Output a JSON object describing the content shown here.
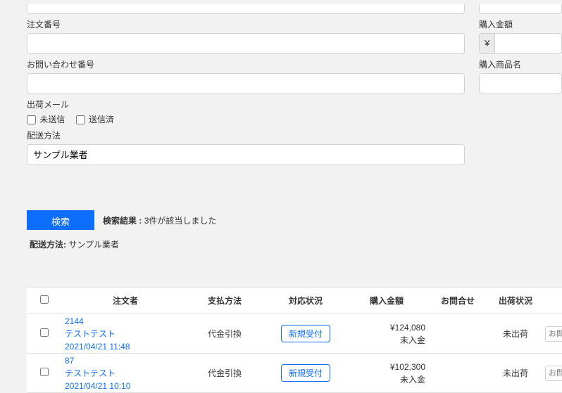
{
  "labels": {
    "orderNumber": "注文番号",
    "inquiryNumber": "お問い合わせ番号",
    "shippingMail": "出荷メール",
    "unsent": "未送信",
    "sent": "送信済",
    "deliveryMethod": "配送方法",
    "purchaseAmount": "購入金額",
    "productName": "購入商品名",
    "yen": "¥",
    "deliverySelected": "サンプル業者"
  },
  "actions": {
    "search": "検索"
  },
  "results": {
    "label": "検索結果 :",
    "count": "3",
    "suffix": "件が該当しました",
    "summaryLabel": "配送方法:",
    "summaryValue": "サンプル業者"
  },
  "table": {
    "headers": {
      "order": "注文者",
      "pay": "支払方法",
      "status": "対応状況",
      "amount": "購入金額",
      "inq": "お問合せ",
      "ship": "出荷状況"
    },
    "rows": [
      {
        "id": "2144",
        "name": "テストテスト",
        "date": "2021/04/21 11:48",
        "pay": "代金引換",
        "status": "新規受付",
        "amount": "¥124,080",
        "paymentState": "未入金",
        "ship": "未出荷",
        "trackLabel": "お問い合わせ"
      },
      {
        "id": "87",
        "name": "テストテスト",
        "date": "2021/04/21 10:10",
        "pay": "代金引換",
        "status": "新規受付",
        "amount": "¥102,300",
        "paymentState": "未入金",
        "ship": "未出荷",
        "trackLabel": "お問い合わせ"
      }
    ]
  }
}
